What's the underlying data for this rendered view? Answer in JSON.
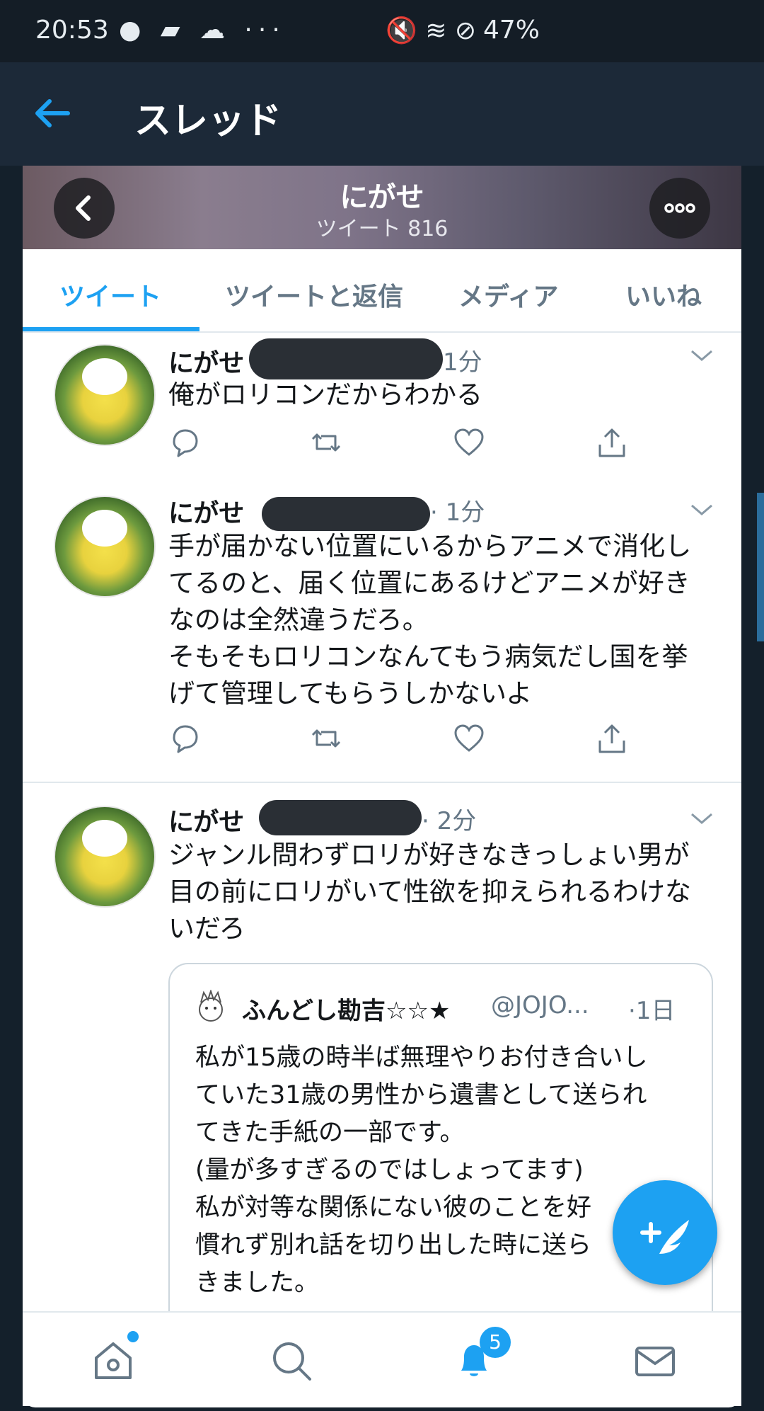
{
  "status_bar": {
    "time": "20:53",
    "left_icons": "● ▰ ☁ ···",
    "right_icons": "🔇 ≋ ⊘",
    "battery": "47%"
  },
  "app_bar": {
    "title": "スレッド"
  },
  "profile": {
    "name": "にがせ",
    "tweet_count": "ツイート 816"
  },
  "tabs": [
    {
      "label": "ツイート"
    },
    {
      "label": "ツイートと返信"
    },
    {
      "label": "メディア"
    },
    {
      "label": "いいね"
    }
  ],
  "tweets": [
    {
      "name": "にがせ",
      "time": "1分",
      "text": "俺がロリコンだからわかる"
    },
    {
      "name": "にがせ",
      "time": "· 1分",
      "text": "手が届かない位置にいるからアニメで消化し\nてるのと、届く位置にあるけどアニメが好き\nなのは全然違うだろ。\nそもそもロリコンなんてもう病気だし国を挙\nげて管理してもらうしかないよ"
    },
    {
      "name": "にがせ",
      "time": "· 2分",
      "text": "ジャンル問わずロリが好きなきっしょい男が\n目の前にロリがいて性欲を抑えられるわけな\nいだろ"
    }
  ],
  "quote": {
    "name": "ふんどし勘吉☆☆★",
    "handle": "@JOJO...",
    "time": "·1日",
    "text": "私が15歳の時半ば無理やりお付き合いし\nていた31歳の男性から遺書として送られ\nてきた手紙の一部です。\n(量が多すぎるのではしょってます)\n私が対等な関係にない彼のことを好\n慣れず別れ話を切り出した時に送ら\nきました。"
  },
  "bottom_nav": {
    "notification_count": "5"
  },
  "colors": {
    "accent": "#1da1f2",
    "appbar": "#1c2938",
    "statusbar": "#141d26"
  }
}
